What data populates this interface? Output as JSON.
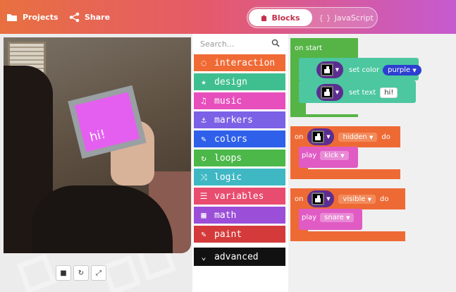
{
  "header": {
    "projects_label": "Projects",
    "share_label": "Share",
    "blocks_label": "Blocks",
    "javascript_label": "JavaScript",
    "icons": {
      "projects": "folder-icon",
      "share": "share-icon",
      "blocks": "puzzle-icon",
      "javascript": "code-braces-icon"
    }
  },
  "simulator": {
    "card_text": "hi!",
    "controls": [
      {
        "name": "stop-button",
        "icon": "stop-icon",
        "glyph": "■"
      },
      {
        "name": "restart-button",
        "icon": "restart-icon",
        "glyph": "↻"
      },
      {
        "name": "fullscreen-button",
        "icon": "expand-icon",
        "glyph": "⤢"
      }
    ]
  },
  "toolbox": {
    "search_placeholder": "Search...",
    "categories": [
      {
        "label": "interaction",
        "color": "#f06a35",
        "icon": "dotted-circle-icon",
        "glyph": "◌"
      },
      {
        "label": "design",
        "color": "#3fbf8f",
        "icon": "star-icon",
        "glyph": "★"
      },
      {
        "label": "music",
        "color": "#e74fbd",
        "icon": "music-note-icon",
        "glyph": "♫"
      },
      {
        "label": "markers",
        "color": "#7b61e6",
        "icon": "anchor-icon",
        "glyph": "⚓"
      },
      {
        "label": "colors",
        "color": "#2e60ea",
        "icon": "brush-icon",
        "glyph": "✎"
      },
      {
        "label": "loops",
        "color": "#4cb84a",
        "icon": "loop-icon",
        "glyph": "↻"
      },
      {
        "label": "logic",
        "color": "#3fb8c4",
        "icon": "shuffle-icon",
        "glyph": "⤨"
      },
      {
        "label": "variables",
        "color": "#e84d6f",
        "icon": "list-icon",
        "glyph": "☰"
      },
      {
        "label": "math",
        "color": "#9b4fd8",
        "icon": "calculator-icon",
        "glyph": "▦"
      },
      {
        "label": "paint",
        "color": "#d43a3a",
        "icon": "paintbrush-icon",
        "glyph": "✎"
      }
    ],
    "advanced_label": "advanced",
    "advanced_color": "#111111"
  },
  "workspace": {
    "on_start": {
      "label": "on start",
      "color": "#56b447",
      "set_color_label": "set color",
      "color_value": "purple",
      "set_text_label": "set text",
      "text_value": "hi!",
      "stmt_color": "#4cc7a0"
    },
    "on_hidden": {
      "on_label": "on",
      "state": "hidden",
      "do_label": "do",
      "play_label": "play",
      "sound": "kick"
    },
    "on_visible": {
      "on_label": "on",
      "state": "visible",
      "do_label": "do",
      "play_label": "play",
      "sound": "snare"
    },
    "event_color": "#ee6a35",
    "play_color": "#e15bc4"
  }
}
